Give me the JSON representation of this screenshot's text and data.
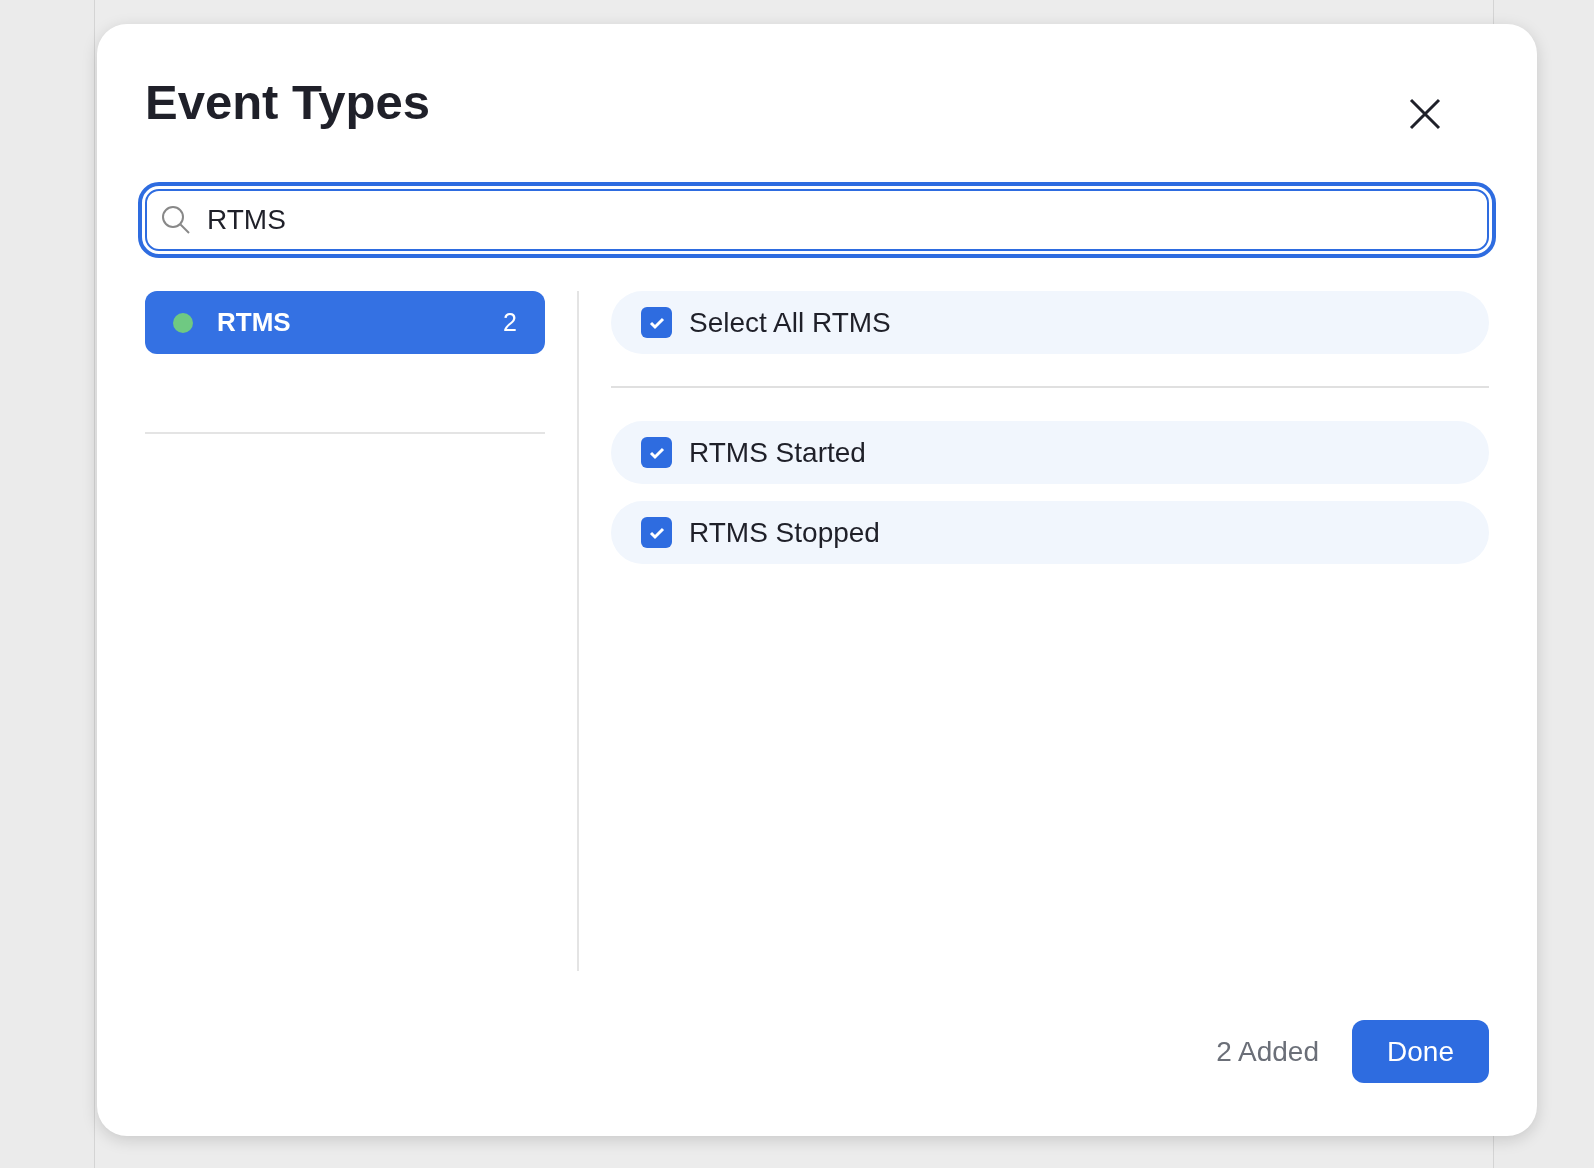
{
  "dialog": {
    "title": "Event Types",
    "search": {
      "value": "RTMS"
    },
    "categories": [
      {
        "label": "RTMS",
        "count": "2",
        "color": "#6fc982",
        "selected": true
      }
    ],
    "select_all": {
      "label": "Select All RTMS",
      "checked": true
    },
    "events": [
      {
        "label": "RTMS Started",
        "checked": true
      },
      {
        "label": "RTMS Stopped",
        "checked": true
      }
    ],
    "added": "2 Added",
    "done": "Done"
  }
}
